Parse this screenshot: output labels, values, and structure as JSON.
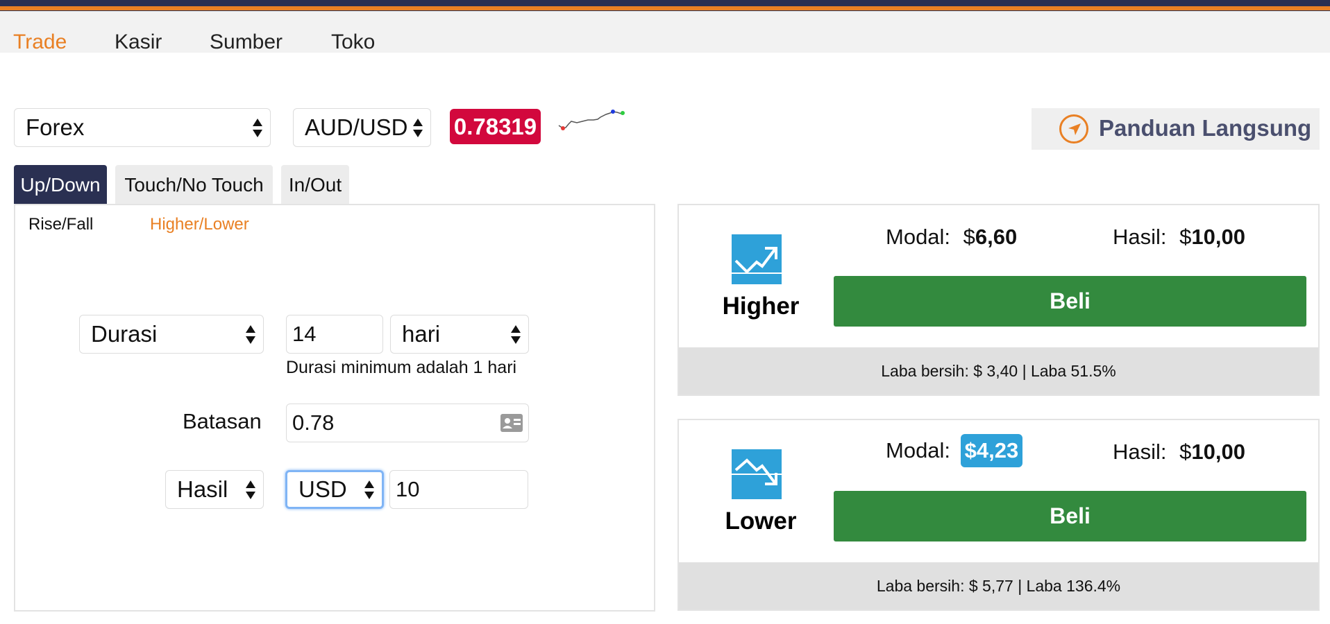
{
  "nav": {
    "items": [
      "Trade",
      "Kasir",
      "Sumber",
      "Toko"
    ],
    "active": "Trade"
  },
  "market": {
    "category": "Forex",
    "symbol": "AUD/USD",
    "price": "0.78319"
  },
  "guide": {
    "label": "Panduan Langsung"
  },
  "tabs": {
    "items": [
      "Up/Down",
      "Touch/No Touch",
      "In/Out"
    ],
    "active": "Up/Down"
  },
  "subtabs": {
    "items": [
      "Rise/Fall",
      "Higher/Lower"
    ],
    "active": "Higher/Lower"
  },
  "form": {
    "duration_type": "Durasi",
    "duration_value": "14",
    "duration_unit": "hari",
    "duration_hint": "Durasi minimum adalah 1 hari",
    "barrier_label": "Batasan",
    "barrier_value": "0.78",
    "basis": "Hasil",
    "currency": "USD",
    "amount": "10"
  },
  "contracts": {
    "higher": {
      "name": "Higher",
      "stake_label": "Modal:",
      "stake_currency": "$",
      "stake_value": "6,60",
      "payout_label": "Hasil:",
      "payout_currency": "$",
      "payout_value": "10,00",
      "buy_label": "Beli",
      "profit_text": "Laba bersih: $ 3,40 | Laba 51.5%"
    },
    "lower": {
      "name": "Lower",
      "stake_label": "Modal:",
      "stake_highlight": "$4,23",
      "payout_label": "Hasil:",
      "payout_currency": "$",
      "payout_value": "10,00",
      "buy_label": "Beli",
      "profit_text": "Laba bersih: $ 5,77 | Laba 136.4%"
    }
  },
  "colors": {
    "accent": "#e98024",
    "navy": "#2a3052",
    "price_red": "#d2083d",
    "buy_green": "#338a3e",
    "icon_blue": "#2ea1d9"
  }
}
